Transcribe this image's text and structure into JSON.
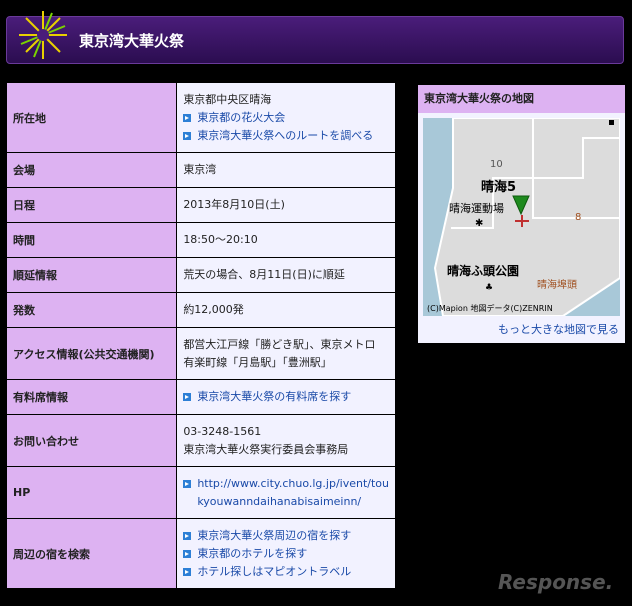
{
  "header": {
    "title": "東京湾大華火祭"
  },
  "rows": {
    "location": {
      "label": "所在地",
      "lines": [
        "東京都中央区晴海"
      ],
      "links": [
        "東京都の花火大会",
        "東京湾大華火祭へのルートを調べる"
      ]
    },
    "venue": {
      "label": "会場",
      "value": "東京湾"
    },
    "date": {
      "label": "日程",
      "value": "2013年8月10日(土)"
    },
    "time": {
      "label": "時間",
      "value": "18:50〜20:10"
    },
    "postpone": {
      "label": "順延情報",
      "value": "荒天の場合、8月11日(日)に順延"
    },
    "shots": {
      "label": "発数",
      "value": "約12,000発"
    },
    "access": {
      "label": "アクセス情報(公共交通機関)",
      "line1": "都営大江戸線「勝どき駅」、東京メトロ",
      "line2": "有楽町線「月島駅」「豊洲駅」"
    },
    "paid": {
      "label": "有料席情報",
      "link": "東京湾大華火祭の有料席を探す"
    },
    "contact": {
      "label": "お問い合わせ",
      "phone": "03-3248-1561",
      "org": "東京湾大華火祭実行委員会事務局"
    },
    "hp": {
      "label": "HP",
      "url1": "http://www.city.chuo.lg.jp/ivent/tou",
      "url2": "kyouwanndaihanabisaimeinn/"
    },
    "inn": {
      "label": "周辺の宿を検索",
      "links": [
        "東京湾大華火祭周辺の宿を探す",
        "東京都のホテルを探す",
        "ホテル探しはマピオントラベル"
      ]
    }
  },
  "map": {
    "title": "東京湾大華火祭の地図",
    "labels": {
      "harumi5": "晴海5",
      "stadium": "晴海運動場",
      "pier_park": "晴海ふ頭公園",
      "pier": "晴海埠頭",
      "num10": "10",
      "num8": "8"
    },
    "copyright": "(C)Mapion 地図データ(C)ZENRIN",
    "more_link": "もっと大きな地図で見る",
    "colors": {
      "land": "#dcdcdc",
      "water": "#a8c8d8",
      "pin": "#1e8a1e"
    }
  },
  "watermark": "Response."
}
